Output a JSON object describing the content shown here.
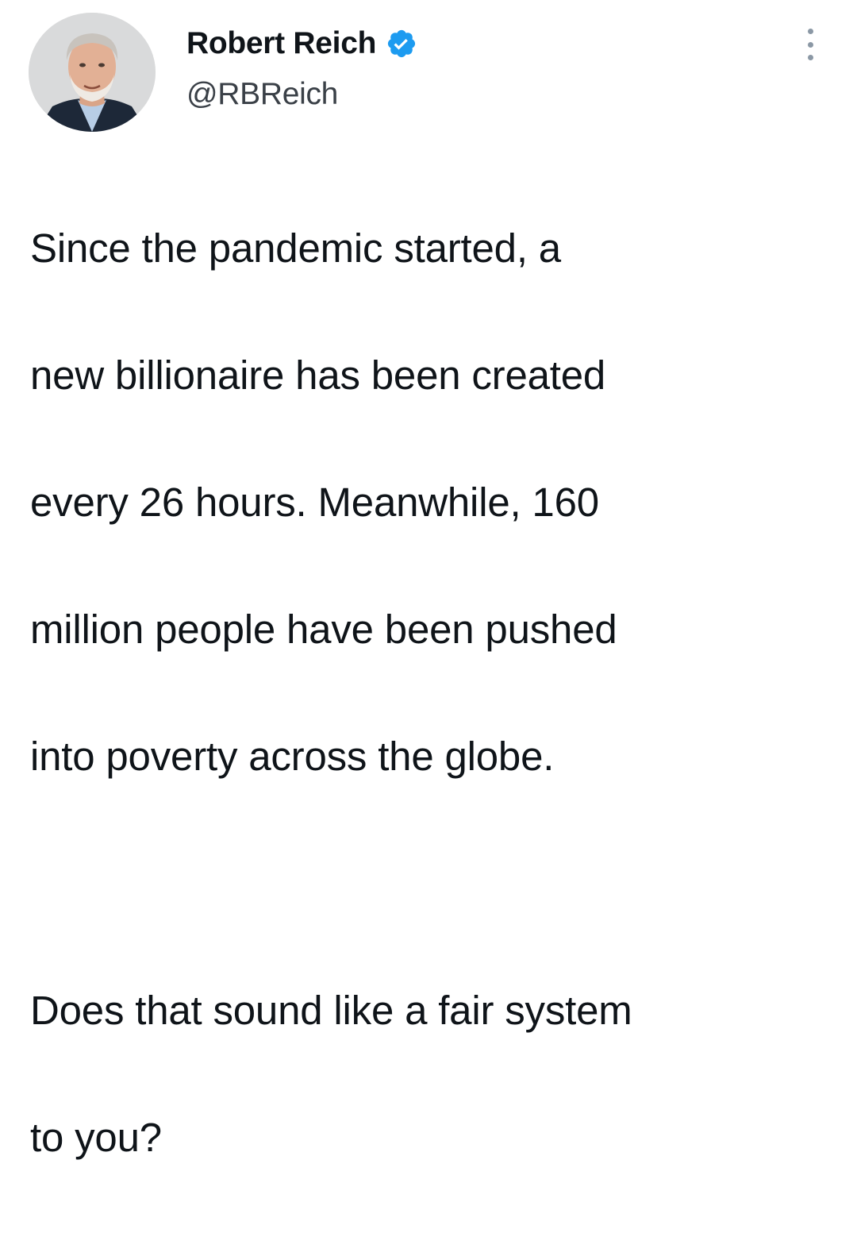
{
  "tweet": {
    "author": {
      "display_name": "Robert Reich",
      "handle": "@RBReich",
      "verified": true,
      "verified_color": "#1d9bf0",
      "avatar_icon": "profile-photo"
    },
    "menu_icon": "more-vertical-icon",
    "text_lines": [
      "Since the pandemic started, a",
      "new billionaire has been created",
      "every 26 hours. Meanwhile, 160",
      "million people have been pushed",
      "into poverty across the globe.",
      "",
      "Does that sound like a fair system",
      "to you?"
    ]
  }
}
